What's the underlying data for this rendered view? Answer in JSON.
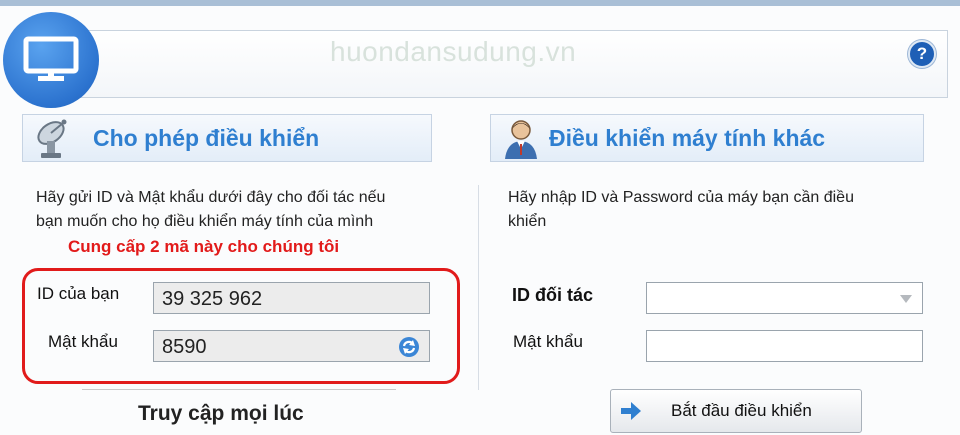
{
  "watermark": "huondansudung.vn",
  "help_label": "?",
  "left": {
    "header": "Cho phép điều khiển",
    "desc_line1": "Hãy gửi ID và Mật khẩu dưới đây cho đối tác nếu",
    "desc_line2": "bạn muốn cho họ điều khiển máy tính của mình",
    "annotation": "Cung cấp 2 mã này cho chúng tôi",
    "id_label": "ID của bạn",
    "id_value": "39 325 962",
    "password_label": "Mật khẩu",
    "password_value": "8590",
    "anytime_label": "Truy cập mọi lúc"
  },
  "right": {
    "header": "Điều khiển máy tính khác",
    "desc_line1": "Hãy nhập ID và Password của máy bạn cần điều",
    "desc_line2": "khiển",
    "partner_id_label": "ID đối tác",
    "partner_id_value": "",
    "password_label": "Mật khẩu",
    "password_value": "",
    "start_button": "Bắt đầu điều khiển"
  },
  "icons": {
    "logo": "monitor-icon",
    "left_header": "satellite-dish-icon",
    "right_header": "user-icon",
    "refresh": "refresh-icon",
    "dropdown": "chevron-down-icon",
    "button": "arrow-right-icon",
    "help": "help-icon"
  },
  "colors": {
    "accent": "#2f7fd0",
    "annotation": "#e21a1a",
    "logo": "#2c73cf"
  }
}
